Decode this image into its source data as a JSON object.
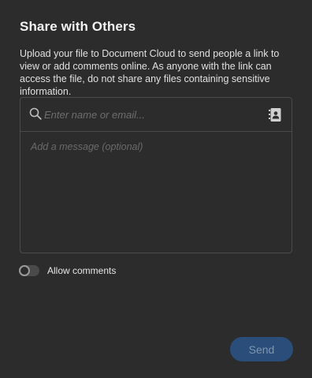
{
  "dialog": {
    "title": "Share with Others",
    "description": "Upload your file to Document Cloud to send people a link to view or add comments online. As anyone with the link can access the file, do not share any files containing sensitive information."
  },
  "recipient": {
    "placeholder": "Enter name or email...",
    "value": ""
  },
  "message": {
    "placeholder": "Add a message (optional)",
    "value": ""
  },
  "allow_comments": {
    "label": "Allow comments",
    "enabled": false
  },
  "send_button": {
    "label": "Send",
    "disabled": true
  },
  "colors": {
    "background": "#2c2c2c",
    "border": "#4b4b4b",
    "send_button_bg": "#2a4d7a",
    "send_button_text": "#7f95b0"
  },
  "icons": {
    "search": "search-icon",
    "contacts": "address-book-icon"
  }
}
